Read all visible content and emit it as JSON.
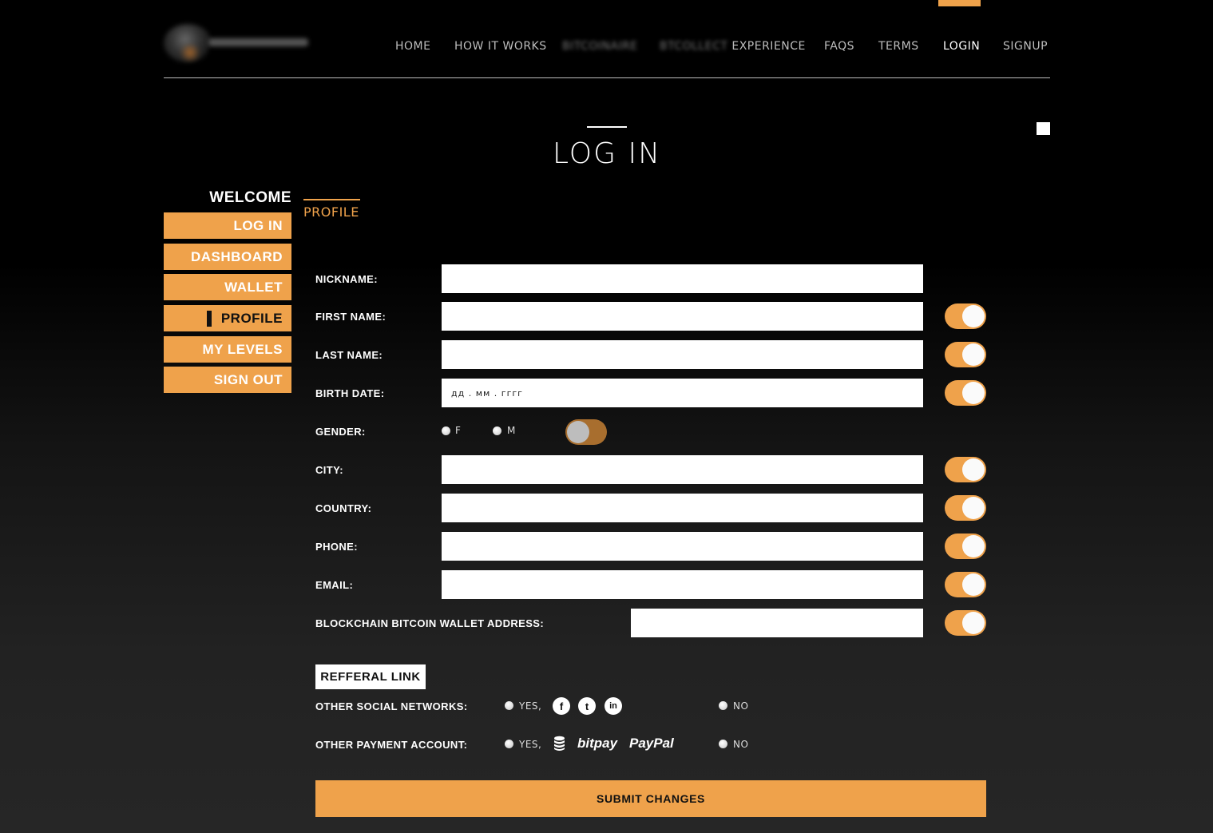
{
  "nav": {
    "home": "HOME",
    "how_it_works": "HOW IT WORKS",
    "blurred_1": "BITCOINAIRE",
    "experience_prefix": "BTCOLLECT",
    "experience": "EXPERIENCE",
    "faqs": "FAQS",
    "terms": "TERMS",
    "login": "LOGIN",
    "signup": "SIGNUP"
  },
  "page": {
    "title": "LOG IN"
  },
  "sidebar": {
    "welcome": "WELCOME",
    "items": [
      {
        "label": "LOG IN"
      },
      {
        "label": "DASHBOARD"
      },
      {
        "label": "WALLET"
      },
      {
        "label": "PROFILE"
      },
      {
        "label": "MY LEVELS"
      },
      {
        "label": "SIGN OUT"
      }
    ]
  },
  "tab": {
    "label": "PROFILE"
  },
  "form": {
    "nickname": {
      "label": "NICKNAME:",
      "value": ""
    },
    "first_name": {
      "label": "FIRST NAME:",
      "value": ""
    },
    "last_name": {
      "label": "LAST NAME:",
      "value": ""
    },
    "birth_date": {
      "label": "BIRTH DATE:",
      "placeholder": "дд . мм . гггг"
    },
    "gender": {
      "label": "GENDER:",
      "option_f": "F",
      "option_m": "M"
    },
    "city": {
      "label": "CITY:",
      "value": ""
    },
    "country": {
      "label": "COUNTRY:",
      "value": ""
    },
    "phone": {
      "label": "PHONE:",
      "value": ""
    },
    "email": {
      "label": "EMAIL:",
      "value": ""
    },
    "wallet": {
      "label": "BLOCKCHAIN BITCOIN WALLET ADDRESS:",
      "value": ""
    }
  },
  "toggles": {
    "first_name": "on",
    "last_name": "on",
    "birth_date": "on",
    "gender": "off",
    "city": "on",
    "country": "on",
    "phone": "on",
    "email": "on",
    "wallet": "on"
  },
  "referral": {
    "label": "REFFERAL LINK"
  },
  "social": {
    "label": "OTHER SOCIAL NETWORKS:",
    "yes": "YES,",
    "no": "NO",
    "icons": {
      "facebook": "f",
      "twitter": "t",
      "linkedin": "in"
    }
  },
  "payment": {
    "label": "OTHER PAYMENT ACCOUNT:",
    "yes": "YES,",
    "no": "NO",
    "bitpay": "bitpay",
    "paypal": "PayPal"
  },
  "submit": {
    "label": "SUBMIT CHANGES"
  },
  "colors": {
    "accent": "#efa24b",
    "background": "#000000"
  }
}
